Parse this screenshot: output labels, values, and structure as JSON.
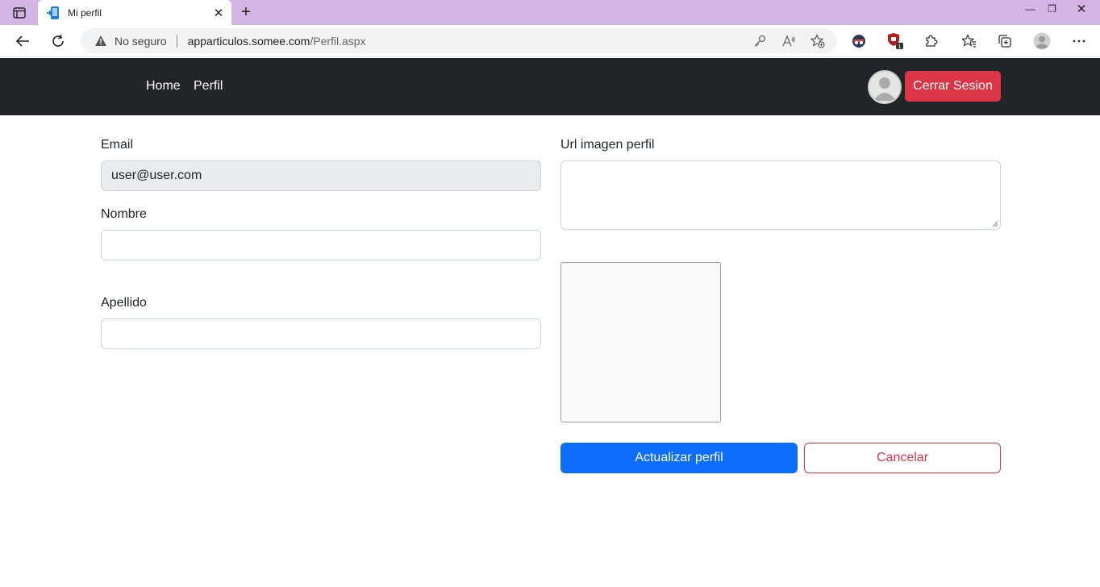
{
  "browser": {
    "tab_title": "Mi perfil",
    "security_label": "No seguro",
    "url_host": "apparticulos.somee.com",
    "url_path": "/Perfil.aspx",
    "extension_badge": "1"
  },
  "navbar": {
    "links": [
      "Home",
      "Perfil"
    ],
    "logout_label": "Cerrar Sesion"
  },
  "form": {
    "email_label": "Email",
    "email_value": "user@user.com",
    "nombre_label": "Nombre",
    "nombre_value": "",
    "apellido_label": "Apellido",
    "apellido_value": "",
    "url_label": "Url imagen perfil",
    "url_value": "",
    "submit_label": "Actualizar perfil",
    "cancel_label": "Cancelar"
  },
  "colors": {
    "tabstrip": "#d4b4e4",
    "navbar": "#212529",
    "danger": "#dc3545",
    "primary": "#0d6efd"
  }
}
